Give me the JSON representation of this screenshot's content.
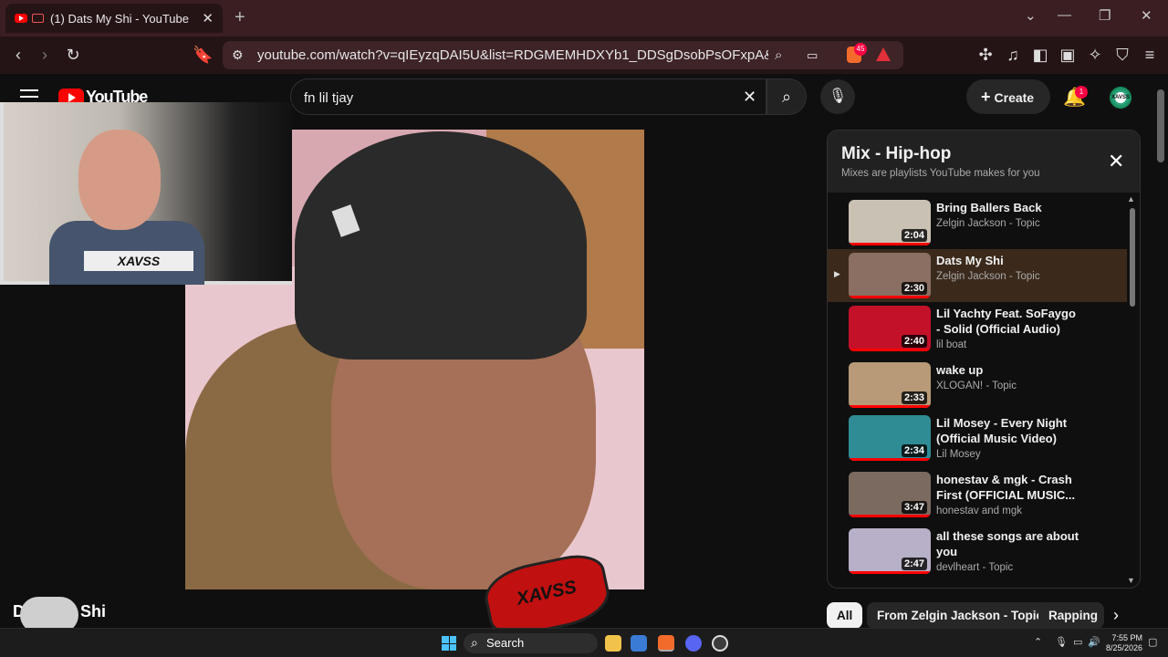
{
  "browser": {
    "tab_title": "(1) Dats My Shi - YouTube",
    "new_tab": "+",
    "url": "youtube.com/watch?v=qIEyzqDAI5U&list=RDGMEMHDXYb1_DDSgDsobPsOFxpA&inde...",
    "brave_badge": "45"
  },
  "youtube": {
    "logo_text": "YouTube",
    "search_value": "fn lil tjay",
    "create_label": "Create",
    "notifications_count": "1",
    "avatar_text": "XAVSS"
  },
  "video": {
    "title": "Dats My Shi",
    "overlay_plate": "XAVSS",
    "overlay_stamp": "XAVSS"
  },
  "playlist": {
    "title": "Mix - Hip-hop",
    "subtitle": "Mixes are playlists YouTube makes for you",
    "items": [
      {
        "title": "Bring Ballers Back",
        "channel": "Zelgin Jackson - Topic",
        "duration": "2:04",
        "active": false,
        "thumb_color": "#c9c2b4"
      },
      {
        "title": "Dats My Shi",
        "channel": "Zelgin Jackson - Topic",
        "duration": "2:30",
        "active": true,
        "thumb_color": "#8a6f62"
      },
      {
        "title": "Lil Yachty Feat. SoFaygo - Solid (Official Audio)",
        "channel": "lil boat",
        "duration": "2:40",
        "active": false,
        "thumb_color": "#c3112a"
      },
      {
        "title": "wake up",
        "channel": "XLOGAN! - Topic",
        "duration": "2:33",
        "active": false,
        "thumb_color": "#b89a78"
      },
      {
        "title": "Lil Mosey - Every Night (Official Music Video)",
        "channel": "Lil Mosey",
        "duration": "2:34",
        "active": false,
        "thumb_color": "#2f8c95"
      },
      {
        "title": "honestav & mgk - Crash First (OFFICIAL MUSIC...",
        "channel": "honestav and mgk",
        "duration": "3:47",
        "active": false,
        "thumb_color": "#7a6a60"
      },
      {
        "title": "all these songs are about you",
        "channel": "devlheart - Topic",
        "duration": "2:47",
        "active": false,
        "thumb_color": "#b8b0c8"
      }
    ]
  },
  "chips": [
    "All",
    "From Zelgin Jackson - Topic",
    "Rapping"
  ],
  "taskbar": {
    "search_label": "Search",
    "time": "7:55 PM",
    "date": "8/25/2026"
  },
  "colors": {
    "accent_red": "#ff0000",
    "tab_strip": "#3a1e22",
    "active_row": "#3b2a1c"
  }
}
